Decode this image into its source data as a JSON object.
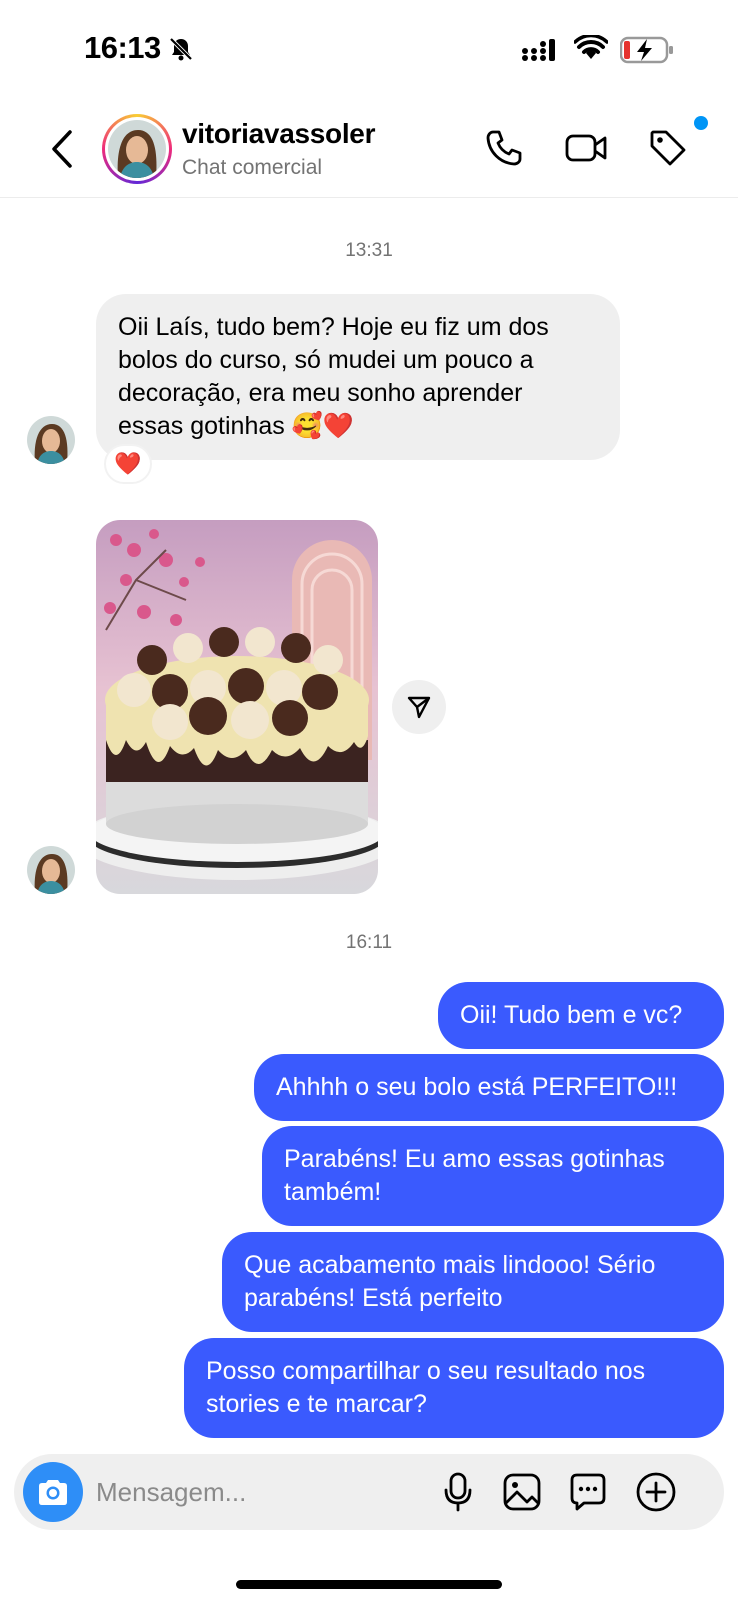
{
  "status_bar": {
    "time": "16:13",
    "icons": [
      "bell-off-icon",
      "cellular-signal-icon",
      "wifi-icon",
      "battery-charging-icon"
    ]
  },
  "header": {
    "username": "vitoriavassoler",
    "subtitle": "Chat comercial",
    "icons": [
      "back-arrow-icon",
      "phone-icon",
      "video-camera-icon",
      "tag-icon"
    ],
    "notification_dot_color": "#0095f6"
  },
  "messages": {
    "timestamp_1": "13:31",
    "incoming_1": {
      "line1": "Oii Laís, tudo bem? Hoje eu fiz um dos",
      "line2": "bolos do curso, só mudei um pouco a",
      "line3": "decoração, era meu sonho aprender",
      "line4": "essas gotinhas 🥰❤️",
      "reaction": "❤️"
    },
    "timestamp_2": "16:11",
    "outgoing": [
      "Oii! Tudo bem e vc?",
      "Ahhhh o seu bolo está PERFEITO!!!",
      [
        "Parabéns! Eu amo essas gotinhas",
        "também!"
      ],
      [
        "Que acabamento mais lindooo! Sério",
        "parabéns! Está perfeito"
      ],
      [
        "Posso compartilhar o seu resultado nos",
        "stories e te marcar?"
      ]
    ]
  },
  "composer": {
    "placeholder": "Mensagem...",
    "icons": [
      "camera-icon",
      "microphone-icon",
      "gallery-icon",
      "sticker-icon",
      "plus-icon"
    ]
  },
  "colors": {
    "outgoing_bubble": "#3a5afe",
    "incoming_bubble": "#efefef",
    "camera_button": "#2e8ef7"
  }
}
